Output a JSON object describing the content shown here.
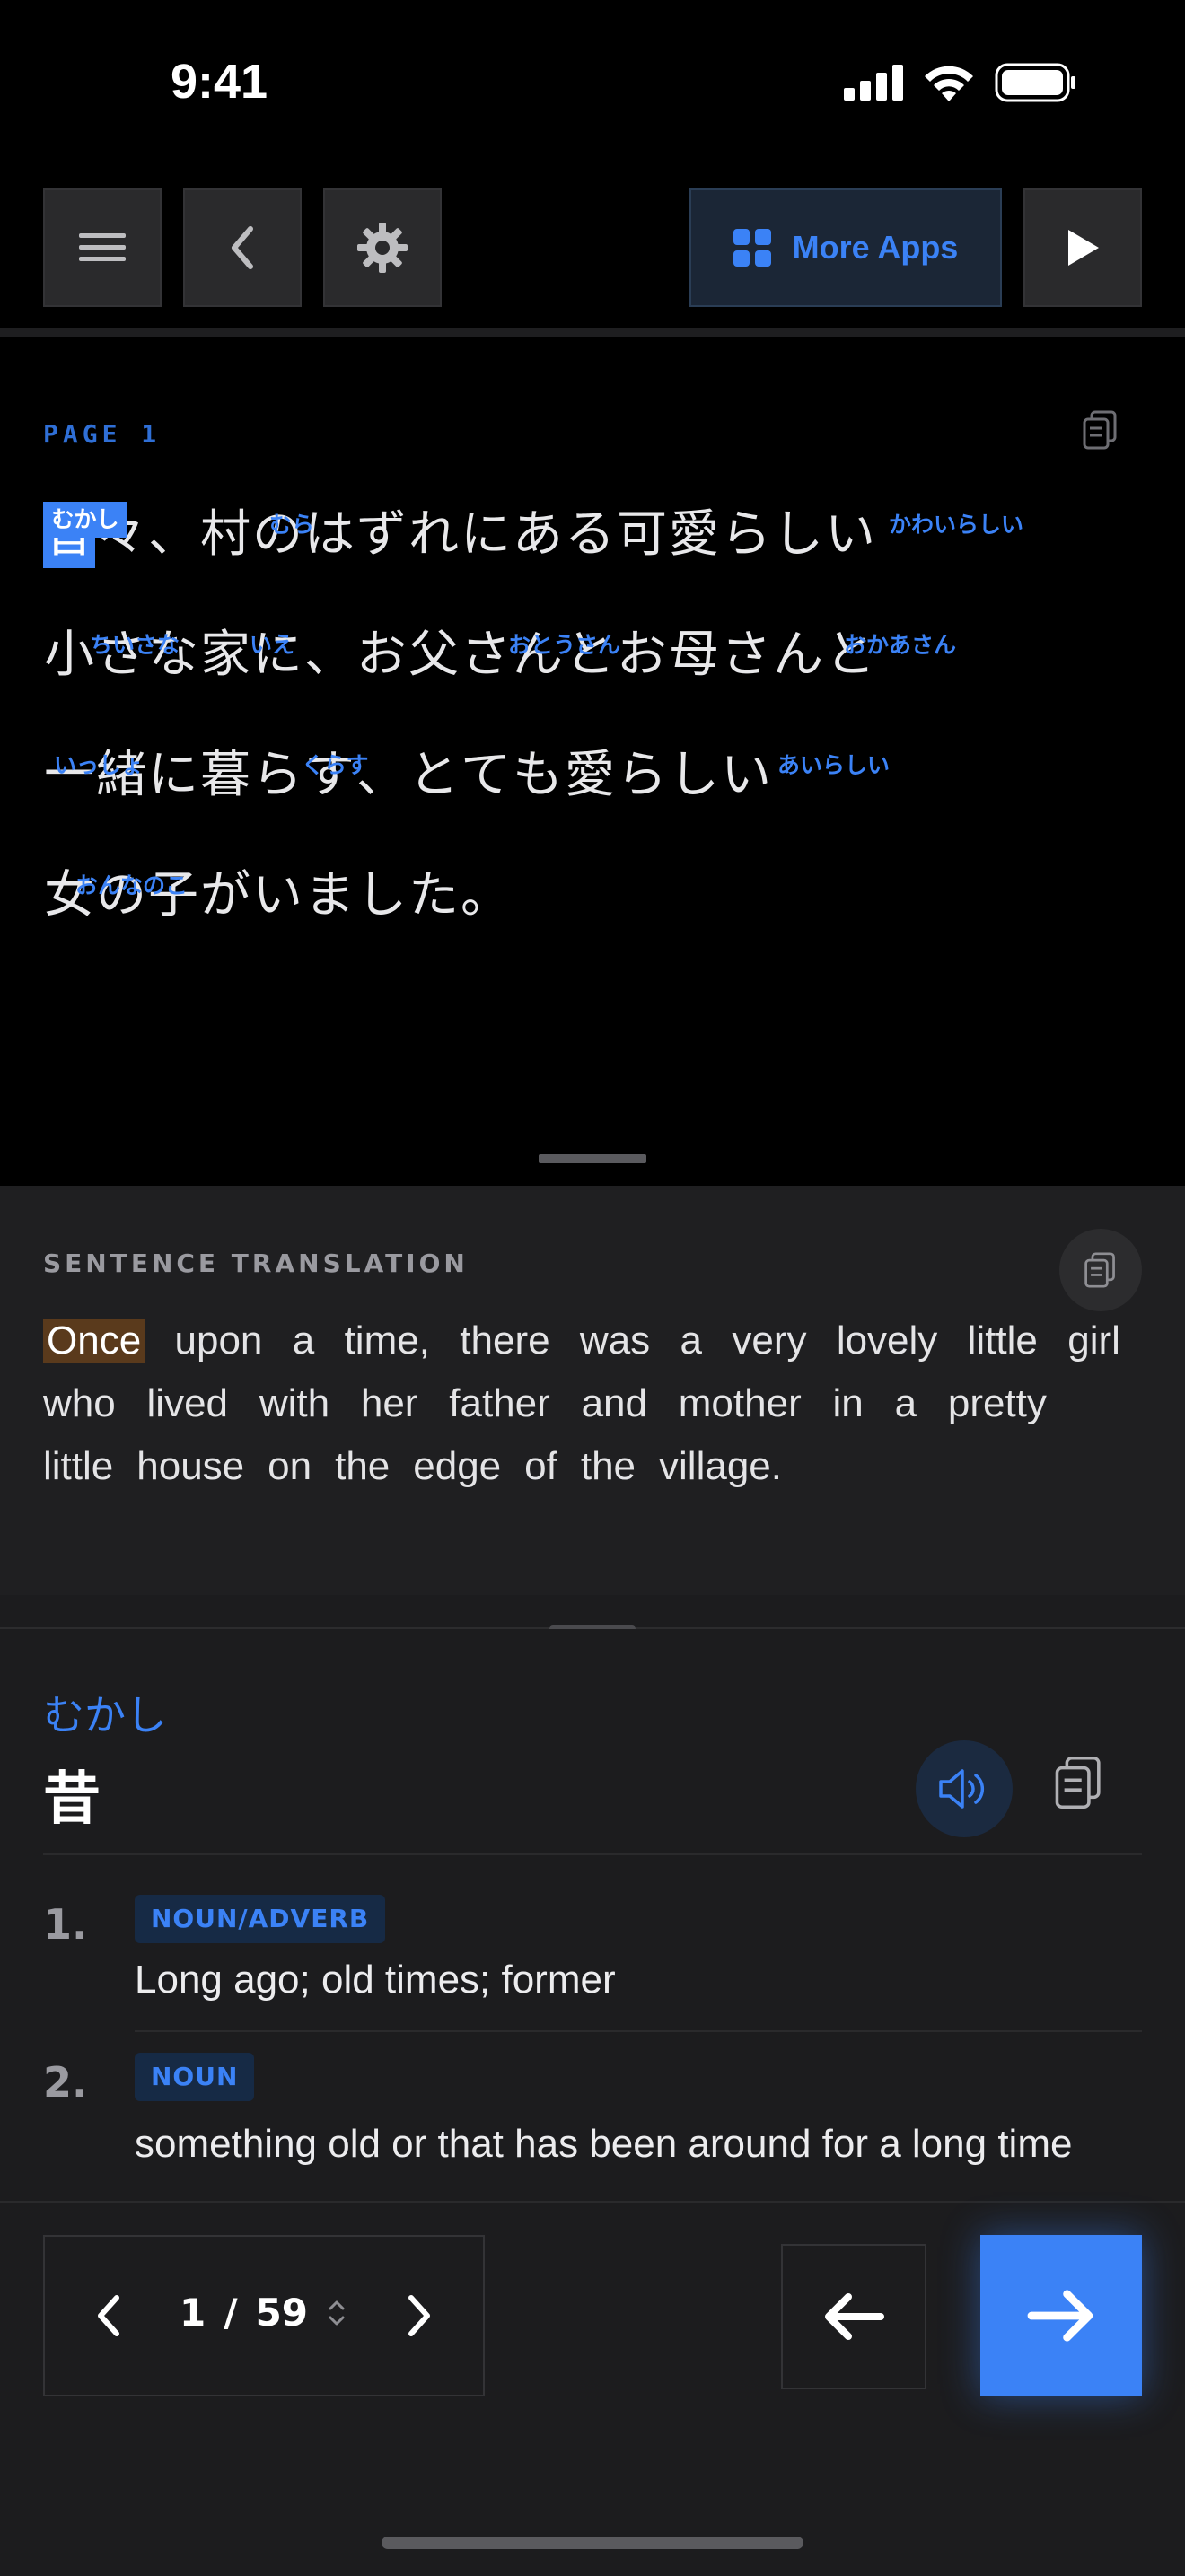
{
  "status": {
    "time": "9:41"
  },
  "toolbar": {
    "more_apps_label": "More Apps"
  },
  "reader": {
    "page_label": "PAGE 1",
    "lines": [
      {
        "chars": [
          "昔",
          "々",
          "、",
          "村",
          "の",
          "は",
          "ず",
          "れ",
          "に",
          "あ",
          "る",
          "可",
          "愛",
          "ら",
          "し",
          "い"
        ]
      },
      {
        "chars": [
          "小",
          "さ",
          "な",
          "家",
          "に",
          "、",
          "お",
          "父",
          "さ",
          "ん",
          "と",
          "お",
          "母",
          "さ",
          "ん",
          "と"
        ]
      },
      {
        "chars": [
          "一",
          "緒",
          "に",
          "暮",
          "ら",
          "す",
          "、",
          "と",
          "て",
          "も",
          "愛",
          "ら",
          "し",
          "い"
        ]
      },
      {
        "chars": [
          "女",
          "の",
          "子",
          "が",
          "い",
          "ま",
          "し",
          "た",
          "。"
        ]
      }
    ],
    "furigana": [
      {
        "text": "むかし"
      },
      {
        "text": "むら"
      },
      {
        "text": "かわいらしい"
      },
      {
        "text": "ちいさな"
      },
      {
        "text": "いえ"
      },
      {
        "text": "おとうさん"
      },
      {
        "text": "おかあさん"
      },
      {
        "text": "いっしょ"
      },
      {
        "text": "くらす"
      },
      {
        "text": "あいらしい"
      },
      {
        "text": "おんなのこ"
      }
    ]
  },
  "translation": {
    "label": "SENTENCE TRANSLATION",
    "lines": [
      [
        "Once",
        "upon",
        "a",
        "time,",
        "there",
        "was",
        "a",
        "very",
        "lovely",
        "little",
        "girl"
      ],
      [
        "who",
        "lived",
        "with",
        "her",
        "father",
        "and",
        "mother",
        "in",
        "a",
        "pretty"
      ],
      [
        "little",
        "house",
        "on",
        "the",
        "edge",
        "of",
        "the",
        "village."
      ]
    ],
    "highlighted_word": "Once"
  },
  "dictionary": {
    "reading": "むかし",
    "word": "昔",
    "definitions": [
      {
        "num": "1.",
        "pos": "NOUN/ADVERB",
        "text": "Long ago; old times; former"
      },
      {
        "num": "2.",
        "pos": "NOUN",
        "text": "something old or that has been around for a long time"
      }
    ]
  },
  "pager": {
    "current": "1",
    "separator": "/",
    "total": "59"
  },
  "colors": {
    "accent": "#3b82f6",
    "highlight_word_bg": "#5a3a1c",
    "background": "#1c1c1e"
  }
}
